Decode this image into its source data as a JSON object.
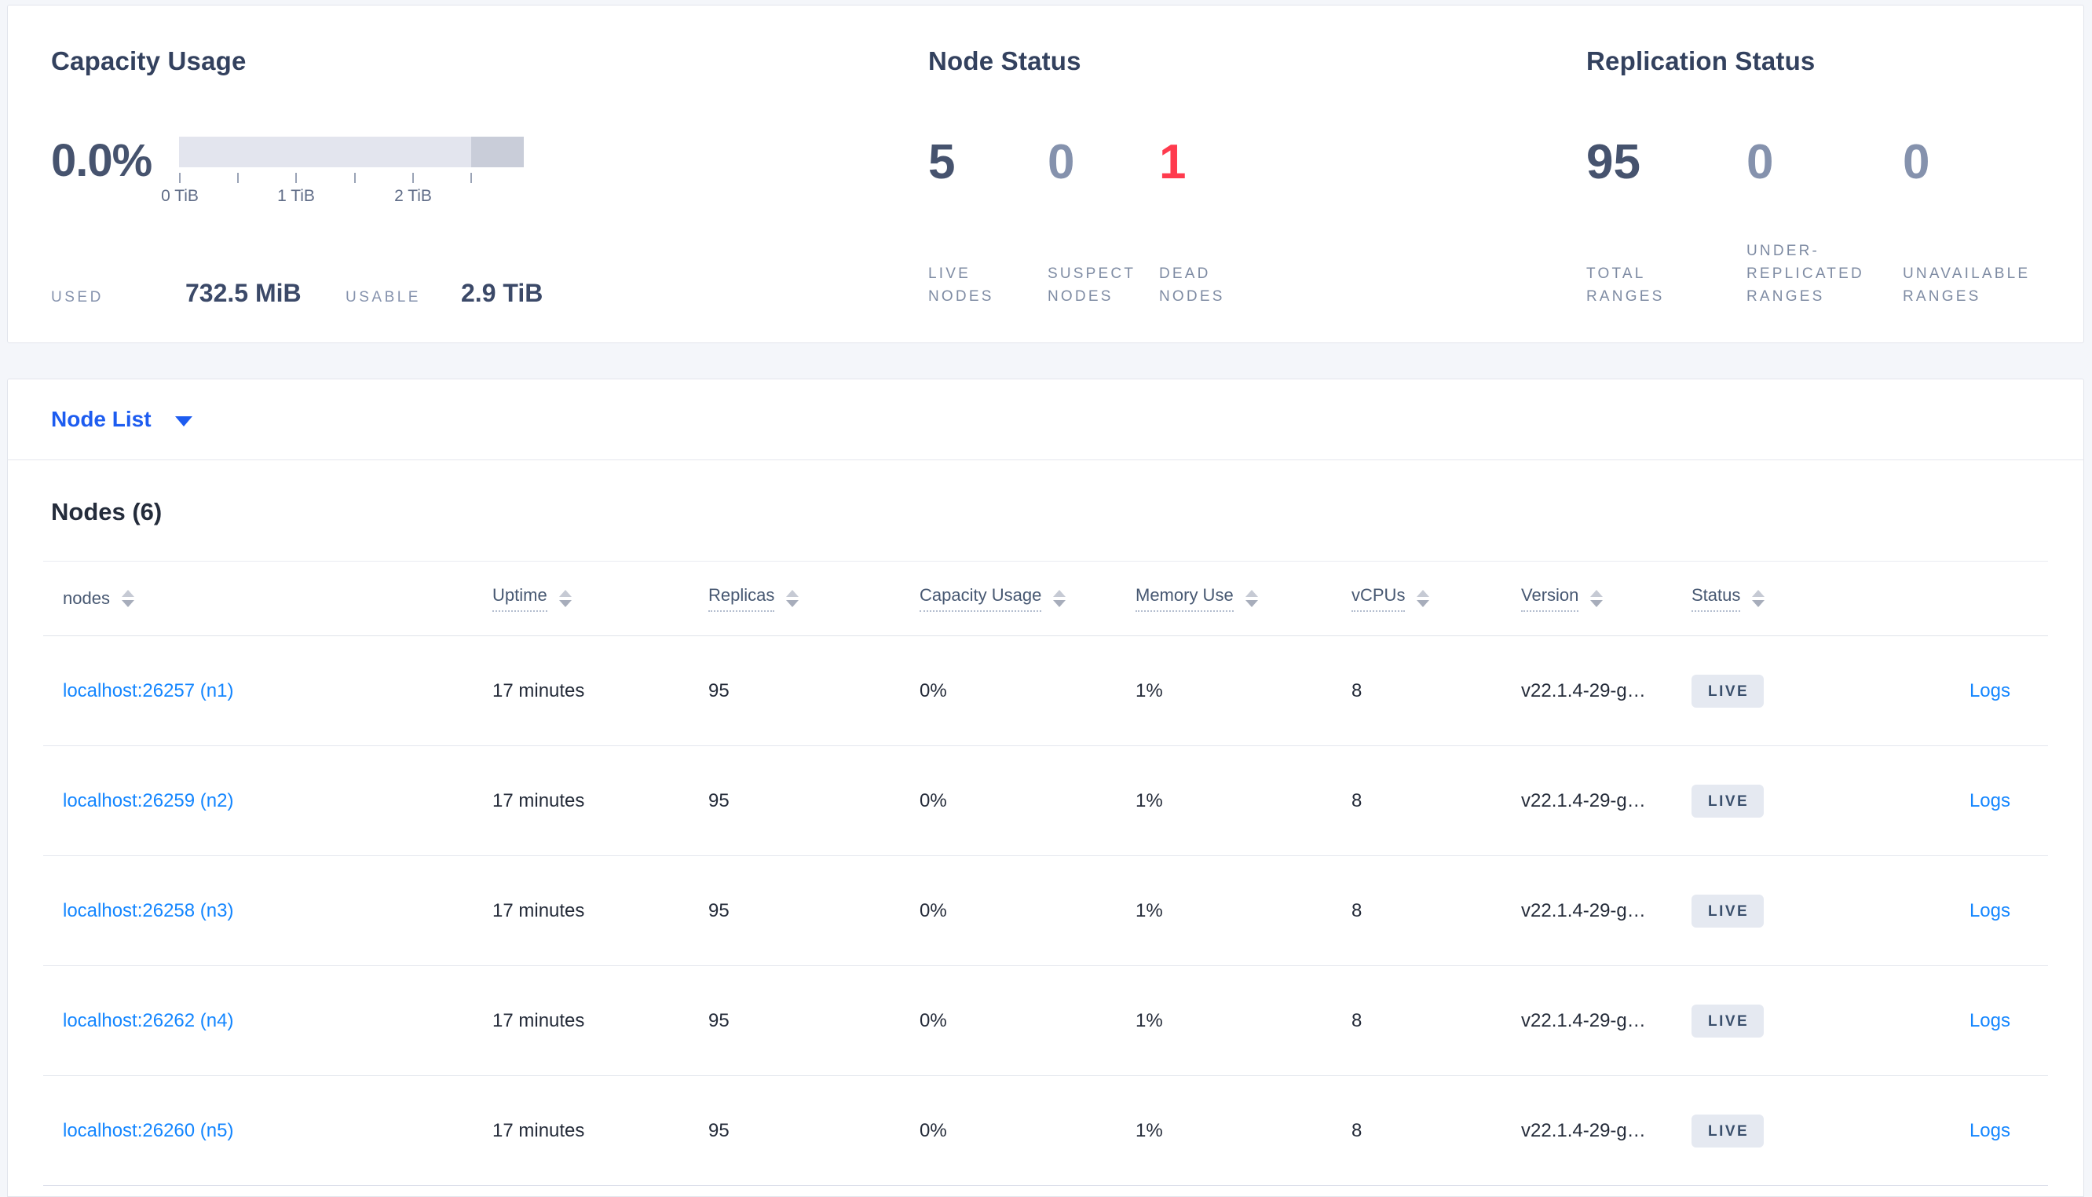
{
  "summary": {
    "capacity": {
      "title": "Capacity Usage",
      "percent": "0.0%",
      "tick_labels": [
        "0 TiB",
        "1 TiB",
        "2 TiB"
      ],
      "used_label": "USED",
      "used_value": "732.5 MiB",
      "usable_label": "USABLE",
      "usable_value": "2.9 TiB"
    },
    "node_status": {
      "title": "Node Status",
      "metrics": [
        {
          "value": "5",
          "label": "LIVE NODES"
        },
        {
          "value": "0",
          "label": "SUSPECT NODES"
        },
        {
          "value": "1",
          "label": "DEAD NODES"
        }
      ]
    },
    "replication": {
      "title": "Replication Status",
      "metrics": [
        {
          "value": "95",
          "label": "TOTAL RANGES"
        },
        {
          "value": "0",
          "label": "UNDER-REPLICATED RANGES"
        },
        {
          "value": "0",
          "label": "UNAVAILABLE RANGES"
        }
      ]
    }
  },
  "node_list": {
    "dropdown_label": "Node List"
  },
  "nodes_section": {
    "heading": "Nodes (6)",
    "columns": [
      {
        "label": "nodes"
      },
      {
        "label": "Uptime"
      },
      {
        "label": "Replicas"
      },
      {
        "label": "Capacity Usage"
      },
      {
        "label": "Memory Use"
      },
      {
        "label": "vCPUs"
      },
      {
        "label": "Version"
      },
      {
        "label": "Status"
      }
    ],
    "rows": [
      {
        "node": "localhost:26257 (n1)",
        "uptime": "17 minutes",
        "replicas": "95",
        "capacity_usage": "0%",
        "memory_use": "1%",
        "vcpus": "8",
        "version": "v22.1.4-29-g…",
        "status": "LIVE",
        "logs": "Logs"
      },
      {
        "node": "localhost:26259 (n2)",
        "uptime": "17 minutes",
        "replicas": "95",
        "capacity_usage": "0%",
        "memory_use": "1%",
        "vcpus": "8",
        "version": "v22.1.4-29-g…",
        "status": "LIVE",
        "logs": "Logs"
      },
      {
        "node": "localhost:26258 (n3)",
        "uptime": "17 minutes",
        "replicas": "95",
        "capacity_usage": "0%",
        "memory_use": "1%",
        "vcpus": "8",
        "version": "v22.1.4-29-g…",
        "status": "LIVE",
        "logs": "Logs"
      },
      {
        "node": "localhost:26262 (n4)",
        "uptime": "17 minutes",
        "replicas": "95",
        "capacity_usage": "0%",
        "memory_use": "1%",
        "vcpus": "8",
        "version": "v22.1.4-29-g…",
        "status": "LIVE",
        "logs": "Logs"
      },
      {
        "node": "localhost:26260 (n5)",
        "uptime": "17 minutes",
        "replicas": "95",
        "capacity_usage": "0%",
        "memory_use": "1%",
        "vcpus": "8",
        "version": "v22.1.4-29-g…",
        "status": "LIVE",
        "logs": "Logs"
      }
    ]
  },
  "colors": {
    "accent_blue": "#1d5cf0",
    "link_blue": "#1486ff",
    "dead_red": "#ff3b4e",
    "dark_slate": "#46536e",
    "light_slate": "#8592ad",
    "badge_bg": "#e5e9f1",
    "bar_light": "#e3e5ee",
    "bar_dark": "#c9cdd9"
  }
}
